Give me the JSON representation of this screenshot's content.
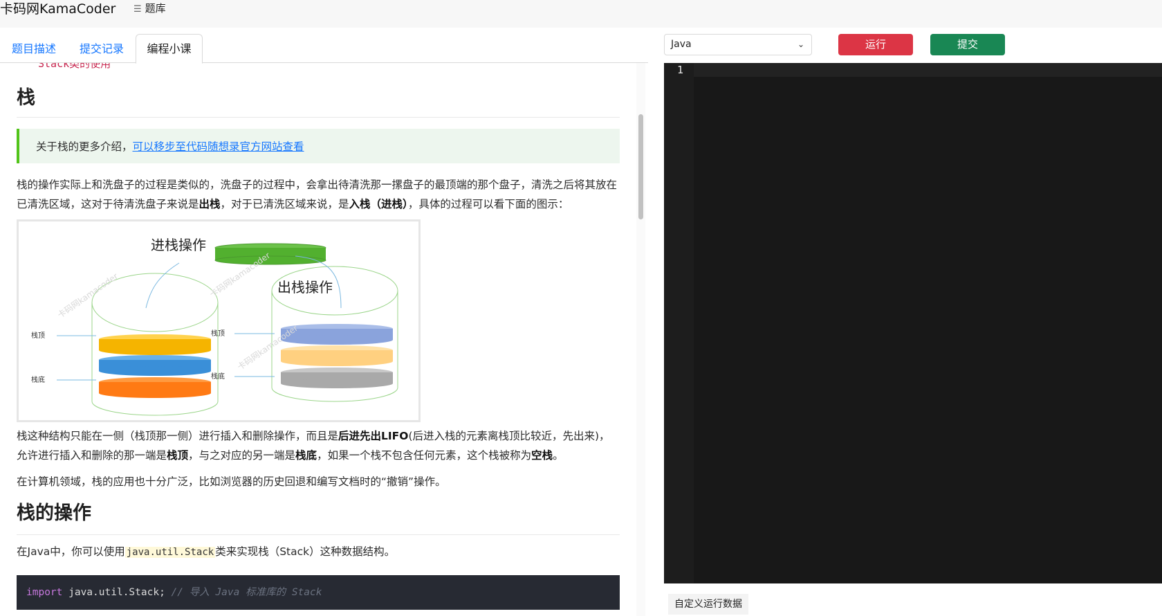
{
  "nav": {
    "brand": "卡码网KamaCoder",
    "library": "题库"
  },
  "tabs": [
    {
      "label": "题目描述"
    },
    {
      "label": "提交记录"
    },
    {
      "label": "编程小课"
    }
  ],
  "content": {
    "cut_off_top": "Stack类的使用",
    "h_stack": "栈",
    "note": {
      "text": "关于栈的更多介绍，",
      "link": "可以移步至代码随想录官方网站查看"
    },
    "p1": {
      "a": "栈的操作实际上和洗盘子的过程是类似的，洗盘子的过程中，会拿出待清洗那一摞盘子的最顶端的那个盘子，清洗之后将其放在已清洗区域，这对于待清洗盘子来说是",
      "b": "出栈",
      "c": "，对于已清洗区域来说，是",
      "d": "入栈（进栈）",
      "e": "，具体的过程可以看下面的图示："
    },
    "figure": {
      "push_title": "进栈操作",
      "pop_title": "出栈操作",
      "top_label": "栈顶",
      "bottom_label": "栈底",
      "watermark": "卡码网kamacoder"
    },
    "p2": {
      "a": "栈这种结构只能在一侧（栈顶那一侧）进行插入和删除操作，而且是",
      "b": "后进先出LIFO",
      "c": "(后进入栈的元素离栈顶比较近，先出来)，允许进行插入和删除的那一端是",
      "d": "栈顶",
      "e": "，与之对应的另一端是",
      "f": "栈底",
      "g": "，如果一个栈不包含任何元素，这个栈被称为",
      "h": "空栈",
      "i": "。"
    },
    "p3": "在计算机领域，栈的应用也十分广泛，比如浏览器的历史回退和编写文档时的“撤销”操作。",
    "h_ops": "栈的操作",
    "p4": {
      "a": "在Java中，你可以使用",
      "code": "java.util.Stack",
      "b": "类来实现栈（Stack）这种数据结构。"
    },
    "code": {
      "kw": "import",
      "stmt": " java.util.Stack;",
      "comment": " // 导入 Java 标准库的 Stack"
    }
  },
  "right": {
    "language": "Java",
    "run_label": "运行",
    "submit_label": "提交",
    "line_number": "1",
    "custom_data_label": "自定义运行数据"
  },
  "colors": {
    "run": "#dc3545",
    "submit": "#198754",
    "link": "#1677ff",
    "note_border": "#52c41a"
  }
}
